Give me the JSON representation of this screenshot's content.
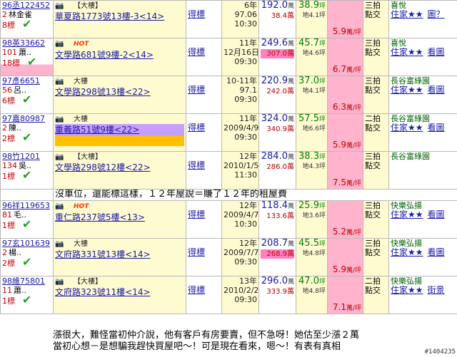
{
  "rows": [
    {
      "id": "96丞122452",
      "owner_count": "2",
      "owner": "林金雀",
      "bids": "8標",
      "tags": "【大樓】",
      "addr_top": "",
      "addr": "華夏路1773號13樓-3<14>",
      "result": "得標",
      "age": "6年",
      "date": "97.06",
      "time": "10:30",
      "price": "192.0",
      "price_unit": "萬",
      "final": "38.4",
      "final_unit": "萬",
      "area": "38.9",
      "area_unit": "坪",
      "land": "地4.1坪",
      "ratio": "5.9",
      "ratio_unit": "萬/坪",
      "round": "三拍",
      "type": "點交",
      "buyer": "喜悅",
      "buyer_line2": "住家★★",
      "buyer_link": "圖？",
      "bar": "none",
      "final_hl": false
    },
    {
      "id": "98英33662",
      "owner_count": "101",
      "owner": "蕭..",
      "bids": "18標",
      "tags": "HOT",
      "addr_top": "",
      "addr": "文學路681號9樓-2<14>",
      "result": "得標",
      "age": "11年",
      "date": "12月16日",
      "time": "09:30",
      "price": "249.6",
      "price_unit": "萬",
      "final": "307.0",
      "final_unit": "萬",
      "area": "45.7",
      "area_unit": "坪",
      "land": "地4.6坪",
      "ratio": "6.7",
      "ratio_unit": "萬/坪",
      "round": "三拍",
      "type": "點交",
      "buyer": "喜悅",
      "buyer_line2": "住家★★",
      "buyer_link": "看圖",
      "bar": "pink",
      "final_hl": true
    },
    {
      "id": "97彥6651",
      "owner_count": "56",
      "owner": "呂..",
      "bids": "6標",
      "tags": "大樓",
      "addr_top": "",
      "addr": "文學路298號13樓<22>",
      "result": "得標",
      "age": "10-11年",
      "date": "97.1",
      "time": "09:30",
      "price": "220.9",
      "price_unit": "萬",
      "final": "242.0",
      "final_unit": "萬",
      "area": "37.0",
      "area_unit": "坪",
      "land": "地4.1坪",
      "ratio": "6.3",
      "ratio_unit": "萬/坪",
      "round": "三拍",
      "type": "點交",
      "buyer": "長谷富綠園",
      "buyer_line2": "住家★★",
      "buyer_link": "看圖",
      "bar": "none",
      "final_hl": false
    },
    {
      "id": "97嘉80987",
      "owner_count": "2",
      "owner": "陳..",
      "bids": "2標",
      "tags": "大樓",
      "addr_top": "",
      "addr": "重義路51號9樓<22>",
      "result": "得標",
      "age": "11年",
      "date": "2009/4/9",
      "time": "09:30",
      "price": "324.0",
      "price_unit": "萬",
      "final": "340.9",
      "final_unit": "萬",
      "area": "57.5",
      "area_unit": "坪",
      "land": "地6.6坪",
      "ratio": "5.9",
      "ratio_unit": "萬/坪",
      "round": "二拍",
      "type": "點交",
      "buyer": "長谷富綠園",
      "buyer_line2": "住家★★",
      "buyer_link": "看圖",
      "bar": "purple",
      "final_hl": false
    },
    {
      "id": "98竹1201",
      "owner_count": "134",
      "owner": "吳..",
      "bids": "1標",
      "tags": "【大樓】",
      "addr_top": "",
      "addr": "文學路298號12樓<22>",
      "result": "得標",
      "age": "12年",
      "date": "2010/1/5",
      "time": "11:30",
      "price": "284.0",
      "price_unit": "萬",
      "final": "286.0",
      "final_unit": "萬",
      "area": "38.3",
      "area_unit": "坪",
      "land": "地4.3坪",
      "ratio": "7.5",
      "ratio_unit": "萬/坪",
      "round": "三拍",
      "type": "點交",
      "buyer": "長谷富綠園",
      "buyer_line2": "",
      "buyer_link": "",
      "bar": "none",
      "final_hl": false
    },
    {
      "id": "96祥119653",
      "owner_count": "81",
      "owner": "毛..",
      "bids": "1標",
      "tags": "HOT",
      "addr_top": "",
      "addr": "重仁路237號5樓<13>",
      "result": "得標",
      "age": "12年",
      "date": "2009/4/7",
      "time": "10:30",
      "price": "118.4",
      "price_unit": "萬",
      "final": "133.6",
      "final_unit": "萬",
      "area": "25.9",
      "area_unit": "坪",
      "land": "地3.6坪",
      "ratio": "5.2",
      "ratio_unit": "萬/坪",
      "round": "三拍",
      "type": "點交",
      "buyer": "快樂弘揚",
      "buyer_line2": "住家★★",
      "buyer_link": "看圖",
      "bar": "none",
      "final_hl": false
    },
    {
      "id": "97玄101639",
      "owner_count": "2",
      "owner": "楊..",
      "bids": "2標",
      "tags": "大樓",
      "addr_top": "",
      "addr": "文府路331號13樓<14>",
      "result": "得標",
      "age": "12年",
      "date": "2009/7/7",
      "time": "09:30",
      "price": "208.7",
      "price_unit": "萬",
      "final": "268.9",
      "final_unit": "萬",
      "area": "45.5",
      "area_unit": "坪",
      "land": "地4.8坪",
      "ratio": "5.9",
      "ratio_unit": "萬/坪",
      "round": "三拍",
      "type": "點交",
      "buyer": "快樂弘揚",
      "buyer_line2": "住家★★",
      "buyer_link": "看圖",
      "bar": "none",
      "final_hl": true
    },
    {
      "id": "98維75801",
      "owner_count": "11",
      "owner": "蕭..",
      "bids": "1標",
      "tags": "【大樓】",
      "addr_top": "",
      "addr": "文府路323號11樓<14>",
      "result": "得標",
      "age": "13年",
      "date": "2010/2/25",
      "time": "09:30",
      "price": "296.0",
      "price_unit": "萬",
      "final": "333.9",
      "final_unit": "萬",
      "area": "47.0",
      "area_unit": "坪",
      "land": "地4.8坪",
      "ratio": "7.1",
      "ratio_unit": "萬/坪",
      "round": "二拍",
      "type": "點交",
      "buyer": "快樂弘揚",
      "buyer_line2": "住家★★",
      "buyer_link": "街景",
      "bar": "none",
      "final_hl": false
    }
  ],
  "notes": {
    "mid": "沒車位，還能標這樣，１２年屋說＝賺了１２年的租屋費",
    "bottom1": "漲很大，難怪當初仲介說，他有客戶有房要賣，但不急呀！她估至少漲２萬",
    "bottom2": "當初心想－是想騙我趕快買屋吧～！可是現在看來，嗯～！有表有真相"
  },
  "badge": "#1404235"
}
